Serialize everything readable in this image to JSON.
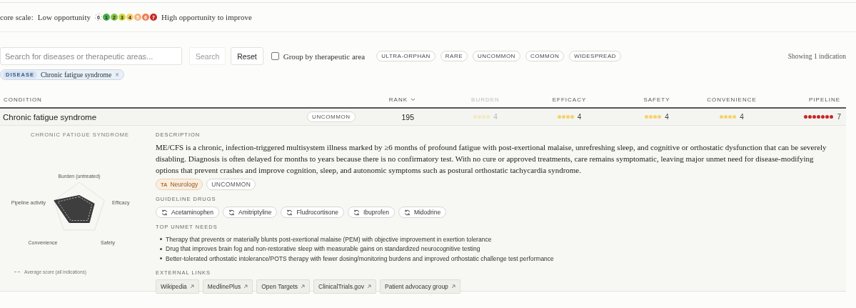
{
  "score_scale": {
    "label": "core scale:",
    "low": "Low opportunity",
    "high": "High opportunity to improve",
    "steps": [
      {
        "label": "0",
        "color": "#ffffff"
      },
      {
        "label": "1",
        "color": "#4caf50"
      },
      {
        "label": "2",
        "color": "#8bc34a"
      },
      {
        "label": "3",
        "color": "#cddc39"
      },
      {
        "label": "4",
        "color": "#f5d36b"
      },
      {
        "label": "5",
        "color": "#f6b17a"
      },
      {
        "label": "6",
        "color": "#ee7d52"
      },
      {
        "label": "7",
        "color": "#c62828"
      }
    ]
  },
  "search": {
    "placeholder": "Search for diseases or therapeutic areas...",
    "search_button": "Search",
    "reset_button": "Reset",
    "group_by": {
      "label": "Group by therapeutic area",
      "checked": false
    },
    "rarity_filters": [
      "ULTRA-ORPHAN",
      "RARE",
      "UNCOMMON",
      "COMMON",
      "WIDESPREAD"
    ],
    "result_count": "Showing 1 indication"
  },
  "active_filters": [
    {
      "type": "DISEASE",
      "value": "Chronic fatigue syndrome",
      "remove": "×"
    }
  ],
  "table": {
    "columns": [
      {
        "label": "CONDITION",
        "muted": false,
        "sorted": false
      },
      {
        "label": "RANK",
        "muted": false,
        "sorted": true
      },
      {
        "label": "BURDEN",
        "muted": true,
        "sorted": false
      },
      {
        "label": "EFFICACY",
        "muted": false,
        "sorted": false
      },
      {
        "label": "SAFETY",
        "muted": false,
        "sorted": false
      },
      {
        "label": "CONVENIENCE",
        "muted": false,
        "sorted": false
      },
      {
        "label": "PIPELINE",
        "muted": false,
        "sorted": false
      }
    ],
    "rows": [
      {
        "condition": "Chronic fatigue syndrome",
        "rarity": "UNCOMMON",
        "rank": "195",
        "expanded": true,
        "scores": [
          {
            "stars": 4,
            "value": "4"
          },
          {
            "stars": 4,
            "value": "4"
          },
          {
            "stars": 4,
            "value": "4"
          },
          {
            "stars": 4,
            "value": "4"
          },
          {
            "stars": 7,
            "value": "7"
          }
        ]
      }
    ]
  },
  "detail": {
    "title": "CHRONIC FATIGUE SYNDROME",
    "radar": {
      "axes": [
        "Burden (untreated)",
        "Efficacy",
        "Safety",
        "Convenience",
        "Pipeline activity"
      ],
      "legend": "Average score (all indications)"
    },
    "description_heading": "DESCRIPTION",
    "description": "ME/CFS is a chronic, infection-triggered multisystem illness marked by ≥6 months of profound fatigue with post-exertional malaise, unrefreshing sleep, and cognitive or orthostatic dysfunction that can be severely disabling. Diagnosis is often delayed for months to years because there is no confirmatory test. With no cure or approved treatments, care remains symptomatic, leaving major unmet need for disease-modifying options that prevent crashes and improve cognition, sleep, and autonomic symptoms such as postural orthostatic tachycardia syndrome.",
    "tags": [
      {
        "kind": "ta",
        "prefix": "TA",
        "label": "Neurology"
      },
      {
        "kind": "rarity",
        "label": "UNCOMMON"
      }
    ],
    "drugs_heading": "GUIDELINE DRUGS",
    "drugs": [
      "Acetaminophen",
      "Amitriptyline",
      "Fludrocortisone",
      "Ibuprofen",
      "Midodrine"
    ],
    "needs_heading": "TOP UNMET NEEDS",
    "needs": [
      "Therapy that prevents or materially blunts post-exertional malaise (PEM) with objective improvement in exertion tolerance",
      "Drug that improves brain fog and non-restorative sleep with measurable gains on standardized neurocognitive testing",
      "Better-tolerated orthostatic intolerance/POTS therapy with fewer dosing/monitoring burdens and improved orthostatic challenge test performance"
    ],
    "links_heading": "EXTERNAL LINKS",
    "links": [
      "Wikipedia",
      "MedlinePlus",
      "Open Targets",
      "ClinicalTrials.gov",
      "Patient advocacy group"
    ]
  }
}
